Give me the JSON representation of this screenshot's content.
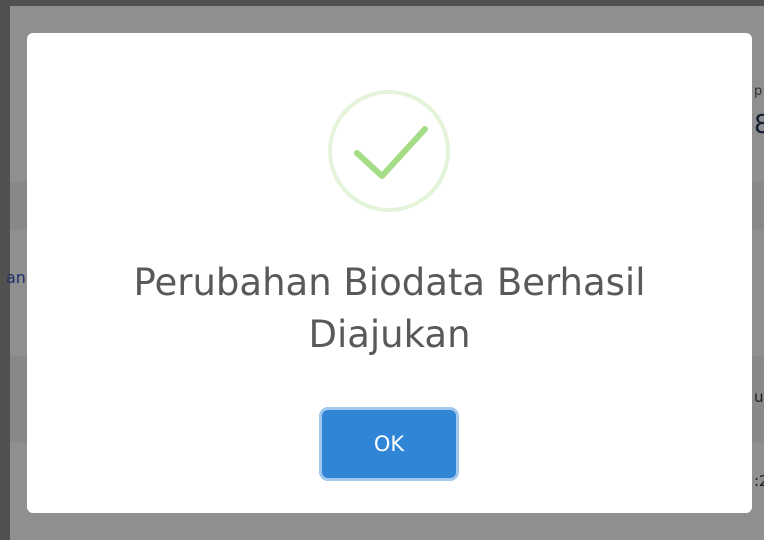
{
  "background": {
    "left_link_fragment": "an",
    "right_small_fragment": "p",
    "right_big_fragment": "8",
    "right_mid_fragment": "u",
    "right_low_fragment": ":2"
  },
  "dialog": {
    "icon": "success-check-icon",
    "title": "Perubahan Biodata Berhasil Diajukan",
    "confirm_label": "OK"
  },
  "colors": {
    "confirm_button": "#3085d6",
    "success_icon": "#a5dc86",
    "title_text": "#595959"
  }
}
